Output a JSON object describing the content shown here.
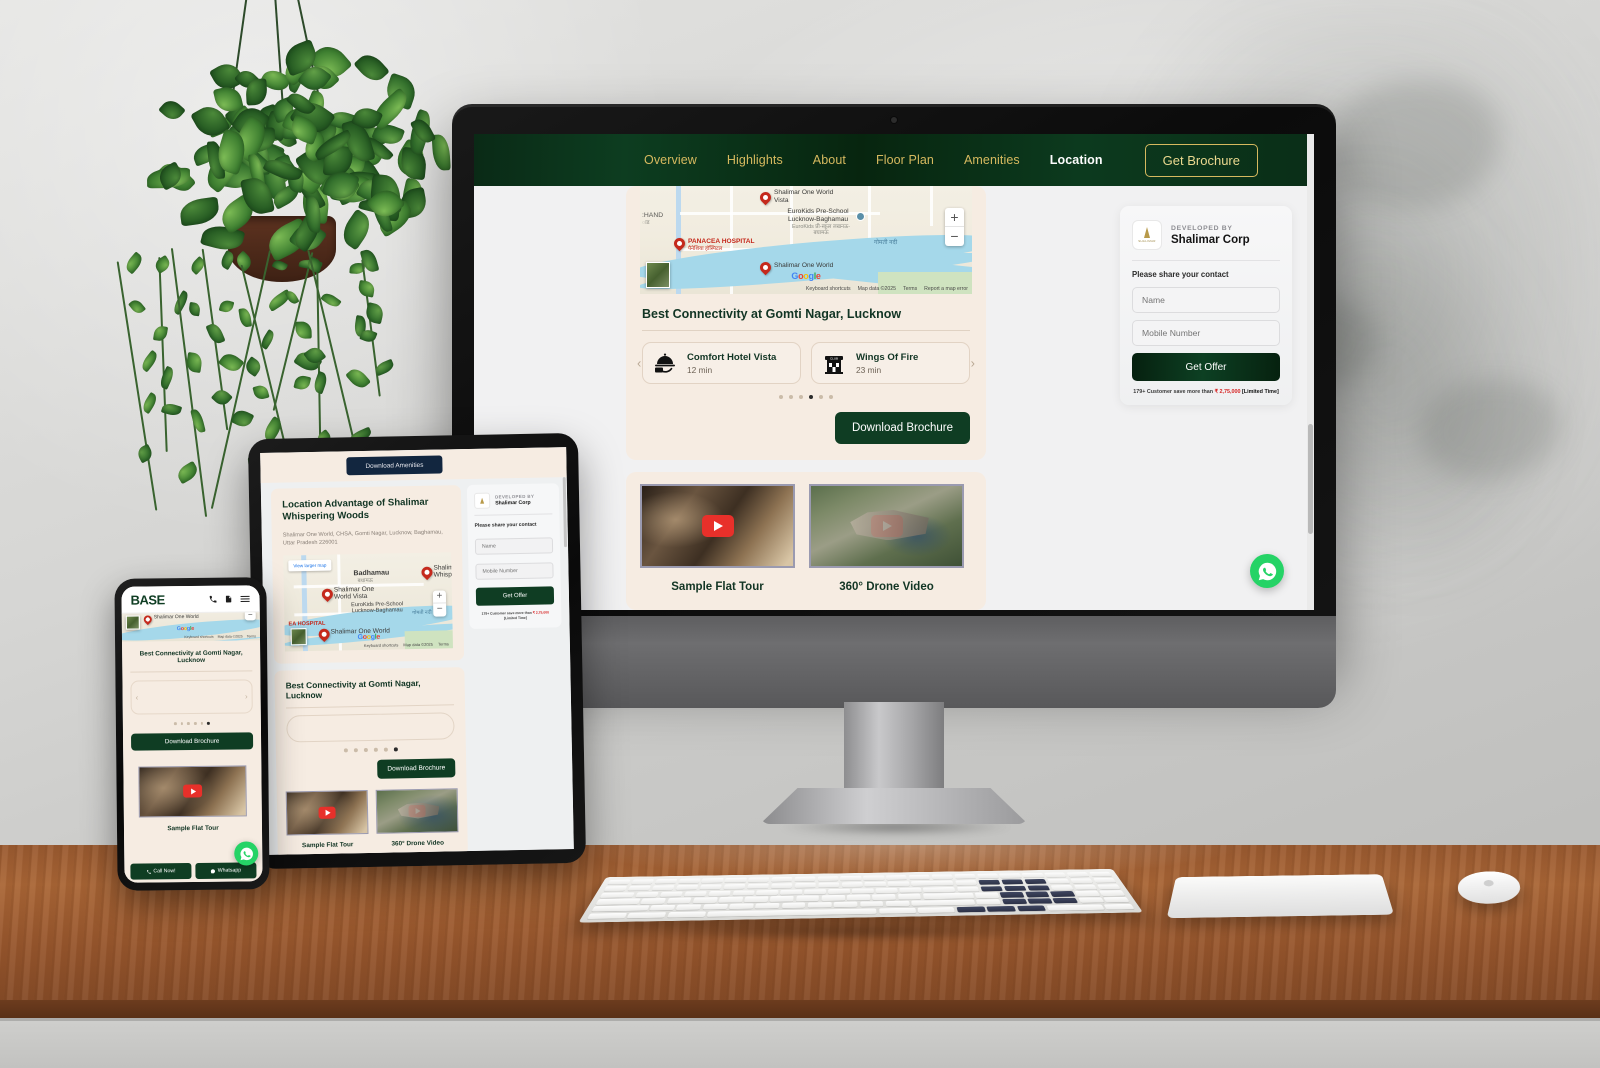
{
  "desktop": {
    "nav": {
      "links": [
        {
          "label": "Overview",
          "active": false
        },
        {
          "label": "Highlights",
          "active": false
        },
        {
          "label": "About",
          "active": false
        },
        {
          "label": "Floor Plan",
          "active": false
        },
        {
          "label": "Amenities",
          "active": false
        },
        {
          "label": "Location",
          "active": true
        }
      ],
      "cta_label": "Get Brochure",
      "bg_color": "#07250f",
      "accent_color": "#d6b95f"
    },
    "map": {
      "labels": [
        {
          "text": "Shalimar One World Vista",
          "type": "place"
        },
        {
          "text": "EuroKids Pre-School Lucknow-Baghamau",
          "type": "place"
        },
        {
          "text": "EuroKids प्री-स्कूल लखनऊ-बघामऊ",
          "type": "hindi"
        },
        {
          "text": "PANACEA HOSPITAL",
          "type": "hospital"
        },
        {
          "text": "पैनेशिया हॉस्पिटल",
          "type": "hindi"
        },
        {
          "text": "Shalimar One World",
          "type": "place"
        },
        {
          "text": "गोमती नदी",
          "type": "river"
        },
        {
          "text": ":HAND",
          "type": "region"
        },
        {
          "text": "ाड",
          "type": "hindi"
        }
      ],
      "zoom_in": "+",
      "zoom_out": "−",
      "google_letters": [
        "G",
        "o",
        "o",
        "g",
        "l",
        "e"
      ],
      "footer": [
        "Keyboard shortcuts",
        "Map data ©2025",
        "Terms",
        "Report a map error"
      ]
    },
    "location_card": {
      "title": "Best Connectivity at Gomti Nagar, Lucknow",
      "connectivity": [
        {
          "name": "Comfort Hotel Vista",
          "time": "12 min",
          "icon": "room-service-icon"
        },
        {
          "name": "Wings Of Fire",
          "time": "23 min",
          "icon": "club-building-icon"
        }
      ],
      "dots_count": 6,
      "active_dot": 3,
      "download_label": "Download Brochure"
    },
    "form": {
      "developed_by_label": "DEVELOPED BY",
      "developer_name": "Shalimar Corp",
      "logo_text": "SHALIMAR",
      "ask_label": "Please share your contact",
      "name_placeholder": "Name",
      "mobile_placeholder": "Mobile Number",
      "submit_label": "Get Offer",
      "fineprint_pre": "179+ Customer save more than ",
      "fineprint_amount": "₹ 2,75,000",
      "fineprint_post": " [Limited Time]"
    },
    "videos": [
      {
        "caption": "Sample Flat Tour",
        "thumb": "flat-interior"
      },
      {
        "caption": "360° Drone Video",
        "thumb": "aerial-township"
      }
    ],
    "whatsapp_icon": "whatsapp-icon"
  },
  "tablet": {
    "amenities_button": "Download Amenities",
    "title": "Location Advantage of Shalimar Whispering Woods",
    "address": "Shalimar One World, CHSA, Gomti Nagar, Lucknow, Baghamau, Uttar Pradesh 226001",
    "view_larger_map": "View larger map",
    "map_labels": [
      "Badhamau",
      "बधामऊ",
      "Shalimar One Whispering",
      "Shalimar One World Vista",
      "EuroKids Pre-School Lucknow-Baghamau",
      "EA HOSPITAL",
      "Shalimar One World",
      "गोमती नदी"
    ],
    "map_footer": [
      "Keyboard shortcuts",
      "Map data ©2025",
      "Terms"
    ],
    "connectivity_title": "Best Connectivity at Gomti Nagar, Lucknow",
    "dots_count": 6,
    "active_dot": 5,
    "download_label": "Download Brochure",
    "form": {
      "developed_by_label": "DEVELOPED BY",
      "developer_name": "Shalimar Corp",
      "ask_label": "Please share your contact",
      "name_placeholder": "Name",
      "mobile_placeholder": "Mobile Number",
      "submit_label": "Get Offer",
      "fineprint_pre": "179+ Customer save more than ",
      "fineprint_amount": "₹ 2,75,000",
      "fineprint_post": "[Limited Time]"
    },
    "videos": [
      {
        "caption": "Sample Flat Tour"
      },
      {
        "caption": "360° Drone Video"
      }
    ]
  },
  "phone": {
    "logo": "BASE",
    "header_icons": [
      "phone-icon",
      "document-icon",
      "hamburger-menu-icon"
    ],
    "map_labels": [
      "Shalimar One World",
      "Keyboard shortcuts",
      "Map data ©2025",
      "Terms"
    ],
    "connectivity_title": "Best Connectivity at Gomti Nagar, Lucknow",
    "dots_count": 6,
    "active_dot": 5,
    "download_label": "Download Brochure",
    "video_caption": "Sample Flat Tour",
    "call_label": "Call Now!",
    "whatsapp_label": "Whatsapp",
    "whatsapp_fab": "whatsapp-icon"
  }
}
